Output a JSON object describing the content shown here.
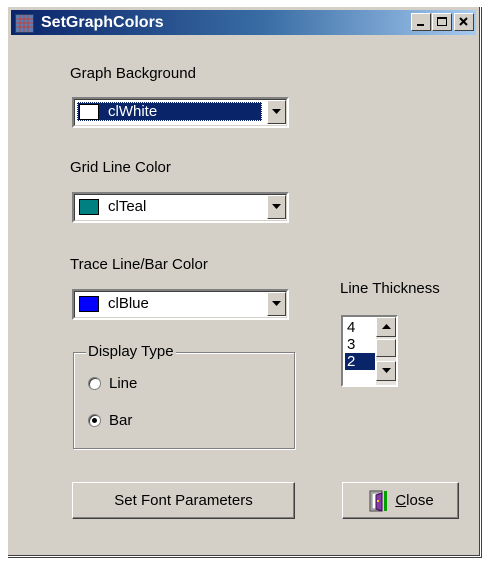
{
  "window": {
    "title": "SetGraphColors",
    "controls": {
      "minimize": "_",
      "maximize": "□",
      "close": "×"
    }
  },
  "graph_background": {
    "label": "Graph Background",
    "selected": "clWhite",
    "swatch_color": "#ffffff"
  },
  "grid_line_color": {
    "label": "Grid Line Color",
    "selected": "clTeal",
    "swatch_color": "#008080"
  },
  "trace_color": {
    "label": "Trace Line/Bar Color",
    "selected": "clBlue",
    "swatch_color": "#0000ff"
  },
  "line_thickness": {
    "label": "Line Thickness",
    "items": [
      "4",
      "3",
      "2"
    ],
    "selected": "2"
  },
  "display_type": {
    "label": "Display Type",
    "options": [
      {
        "label": "Line",
        "checked": false
      },
      {
        "label": "Bar",
        "checked": true
      }
    ]
  },
  "buttons": {
    "set_font": "Set Font Parameters",
    "close_mnemonic": "C",
    "close_rest": "lose"
  },
  "colors": {
    "face": "#d4d0c8",
    "title_start": "#0a246a",
    "title_end": "#a6caf0",
    "selection": "#0a246a"
  }
}
